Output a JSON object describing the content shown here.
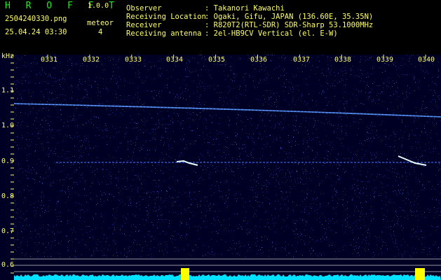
{
  "app": {
    "name": "H R O F F T",
    "version": "1.0.0"
  },
  "file": {
    "name": "2504240330.png",
    "datetime": "25.04.24 03:30"
  },
  "meteor": {
    "label": "meteor",
    "count": "4"
  },
  "info": {
    "rows": [
      {
        "key": "Observer",
        "value": ": Takanori Kawachi"
      },
      {
        "key": "Receiving Location",
        "value": ": Ogaki, Gifu, JAPAN (136.60E, 35.35N)"
      },
      {
        "key": "Receiver",
        "value": ": R820T2(RTL-SDR) SDR-Sharp 53.1000MHz"
      },
      {
        "key": "Receiving antenna",
        "value": ": 2el-HB9CV Vertical (el. E-W)"
      }
    ]
  },
  "axis": {
    "unit": "kHz",
    "y_ticks": [
      "1.1",
      "1.0",
      "0.9",
      "0.8",
      "0.7",
      "0.6"
    ],
    "x_ticks": [
      "0331",
      "0332",
      "0333",
      "0334",
      "0335",
      "0336",
      "0337",
      "0338",
      "0339",
      "0340"
    ]
  },
  "colors": {
    "header_text": "#ffff66",
    "logo": "#27e627",
    "waterfall_bg": "#000024",
    "signal": "#4a8cff",
    "echo": "#e8ffff",
    "sidebar": "#00e0ff",
    "peak": "#ffff00"
  }
}
